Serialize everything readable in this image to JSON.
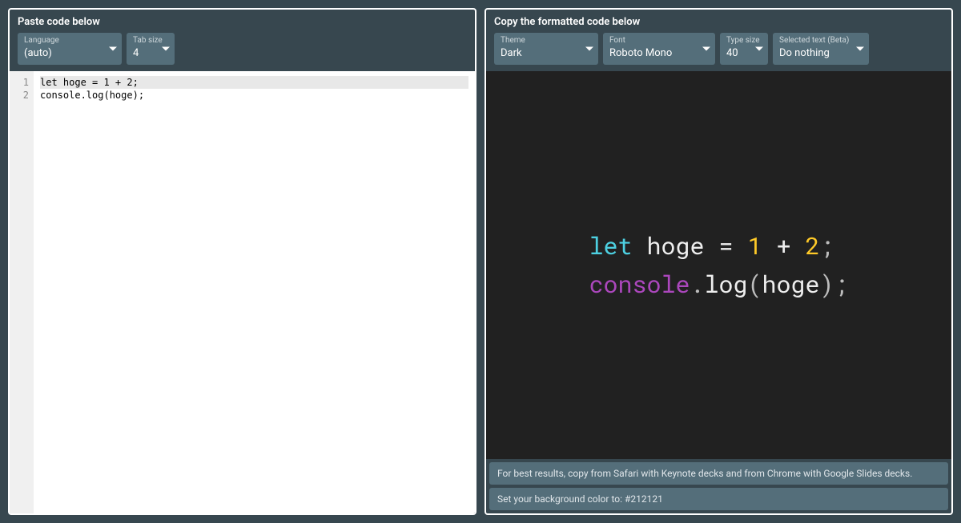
{
  "left": {
    "title": "Paste code below",
    "language": {
      "label": "Language",
      "value": "(auto)"
    },
    "tabsize": {
      "label": "Tab size",
      "value": "4"
    },
    "lines": [
      "1",
      "2"
    ],
    "code_line1": "let hoge = 1 + 2;",
    "code_line2": "console.log(hoge);"
  },
  "right": {
    "title": "Copy the formatted code below",
    "theme": {
      "label": "Theme",
      "value": "Dark"
    },
    "font": {
      "label": "Font",
      "value": "Roboto Mono"
    },
    "typesize": {
      "label": "Type size",
      "value": "40"
    },
    "selected": {
      "label": "Selected text (Beta)",
      "value": "Do nothing"
    },
    "formatted": {
      "line1": {
        "kw": "let",
        "sp1": " ",
        "id": "hoge",
        "sp2": " ",
        "eq": "=",
        "sp3": " ",
        "n1": "1",
        "sp4": " ",
        "plus": "+",
        "sp5": " ",
        "n2": "2",
        "semi": ";"
      },
      "line2": {
        "obj": "console",
        "dot": ".",
        "method": "log",
        "lp": "(",
        "arg": "hoge",
        "rp": ")",
        "semi": ";"
      }
    },
    "hint1": "For best results, copy from Safari with Keynote decks and from Chrome with Google Slides decks.",
    "hint2": "Set your background color to: #212121",
    "bg_color": "#212121"
  }
}
